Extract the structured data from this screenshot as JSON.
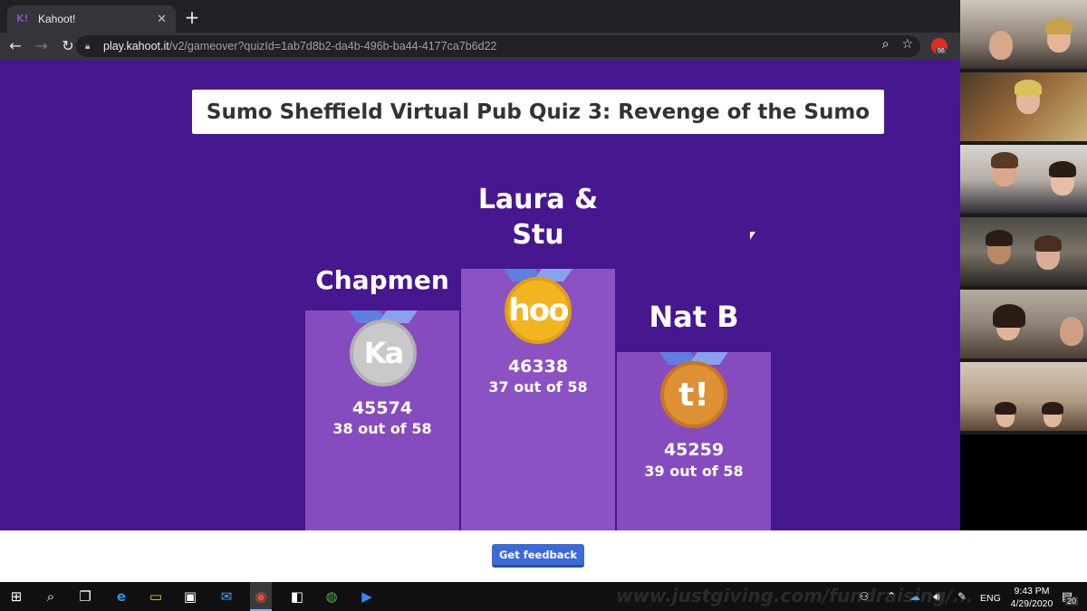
{
  "browser": {
    "tab_title": "Kahoot!",
    "favicon_text": "K!",
    "url_host": "play.kahoot.it",
    "url_path": "/v2/gameover?quizId=1ab7d8b2-da4b-496b-ba44-4177ca7b6d22",
    "extension_badge": "56"
  },
  "quiz": {
    "title": "Sumo Sheffield Virtual Pub Quiz 3: Revenge of the Sumo"
  },
  "podium": {
    "second": {
      "name": "Chapmen",
      "medal_text": "Ka",
      "score": "45574",
      "correct": "38 out of 58"
    },
    "first": {
      "name_line1": "Laura &",
      "name_line2": "Stu",
      "medal_text": "hoo",
      "score": "46338",
      "correct": "37 out of 58"
    },
    "third": {
      "name": "Nat B",
      "medal_text": "t!",
      "score": "45259",
      "correct": "39 out of 58"
    }
  },
  "footer": {
    "feedback_label": "Get feedback"
  },
  "taskbar": {
    "watermark": "www.justgiving.com/fundraising/...",
    "language": "ENG",
    "time": "9:43 PM",
    "date": "4/29/2020",
    "notification_count": "20"
  },
  "colors": {
    "kahoot_purple": "#46178f",
    "podium": "#864cbf",
    "button_blue": "#3d6ad6",
    "gold": "#f2b51f",
    "silver": "#c9c9c9",
    "bronze": "#dd9133"
  }
}
